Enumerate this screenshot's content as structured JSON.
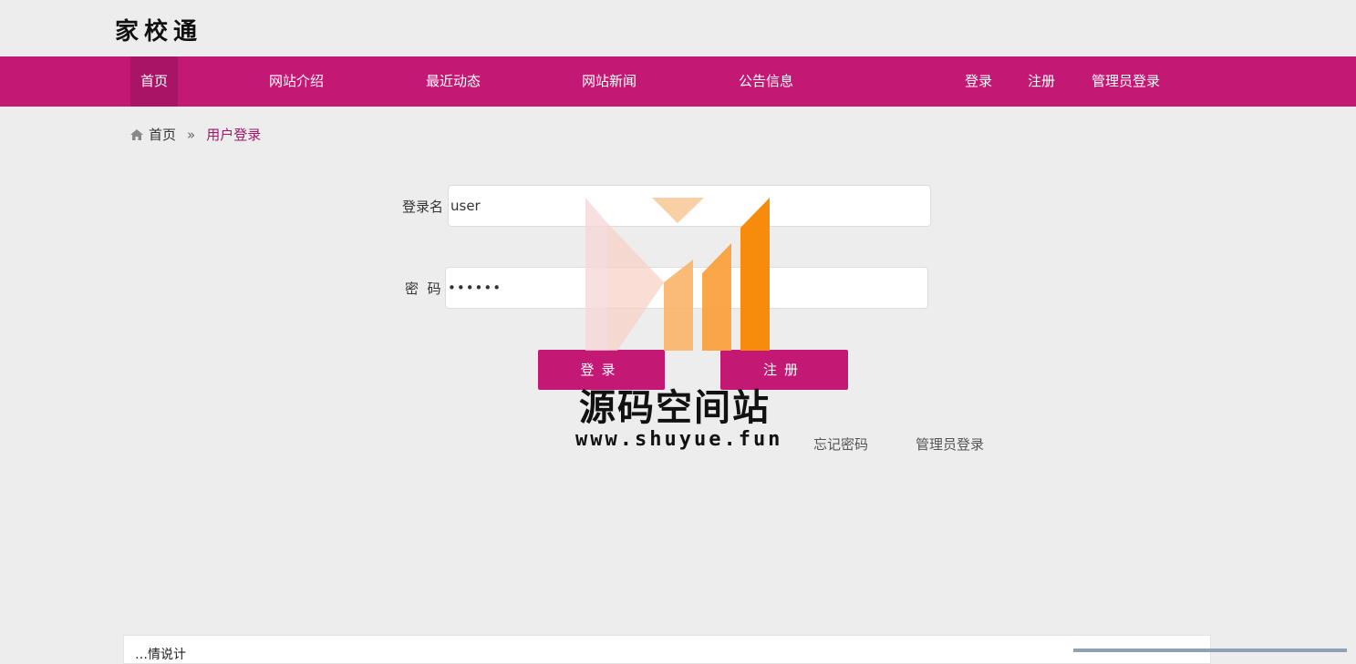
{
  "header": {
    "site_title": "家校通"
  },
  "nav": {
    "items": [
      {
        "label": "首页",
        "active": true
      },
      {
        "label": "网站介绍"
      },
      {
        "label": "最近动态"
      },
      {
        "label": "网站新闻"
      },
      {
        "label": "公告信息"
      }
    ],
    "right_items": [
      {
        "label": "登录"
      },
      {
        "label": "注册"
      },
      {
        "label": "管理员登录"
      }
    ],
    "color": "#c31975"
  },
  "breadcrumb": {
    "home_label": "首页",
    "separator": "»",
    "current": "用户登录",
    "icon": "home-icon"
  },
  "login_form": {
    "username_label": "登录名",
    "username_value": "user",
    "password_label": "密  码",
    "password_value": "••••••",
    "login_button": "登录",
    "register_button": "注册",
    "forgot_link": "忘记密码",
    "admin_link": "管理员登录"
  },
  "watermark": {
    "title": "源码空间站",
    "url": "www.shuyue.fun"
  },
  "bottom_panel": {
    "text": "…情说计"
  }
}
